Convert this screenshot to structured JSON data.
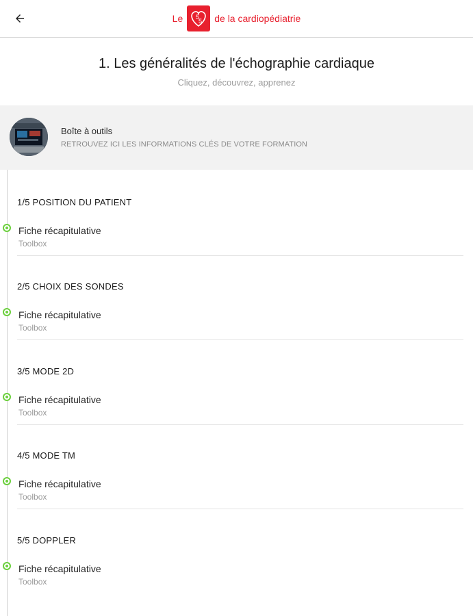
{
  "header": {
    "brand_prefix": "Le",
    "brand_suffix": "de la cardiopédiatrie",
    "logo_text_top": "5",
    "logo_text_bottom": "5",
    "accent_color": "#e8202e"
  },
  "page": {
    "title": "1. Les généralités de l'échographie cardiaque",
    "subtitle": "Cliquez, découvrez, apprenez"
  },
  "toolbox": {
    "title": "Boîte à outils",
    "subtitle": "RETROUVEZ ICI LES INFORMATIONS CLÉS DE VOTRE FORMATION"
  },
  "sections": [
    {
      "title": "1/5 POSITION DU PATIENT",
      "item_title": "Fiche récapitulative",
      "item_sub": "Toolbox"
    },
    {
      "title": "2/5 CHOIX DES SONDES",
      "item_title": "Fiche récapitulative",
      "item_sub": "Toolbox"
    },
    {
      "title": "3/5 MODE 2D",
      "item_title": "Fiche récapitulative",
      "item_sub": "Toolbox"
    },
    {
      "title": "4/5 MODE TM",
      "item_title": "Fiche récapitulative",
      "item_sub": "Toolbox"
    },
    {
      "title": "5/5 DOPPLER",
      "item_title": "Fiche récapitulative",
      "item_sub": "Toolbox"
    }
  ],
  "status_color": "#6bcf3d"
}
